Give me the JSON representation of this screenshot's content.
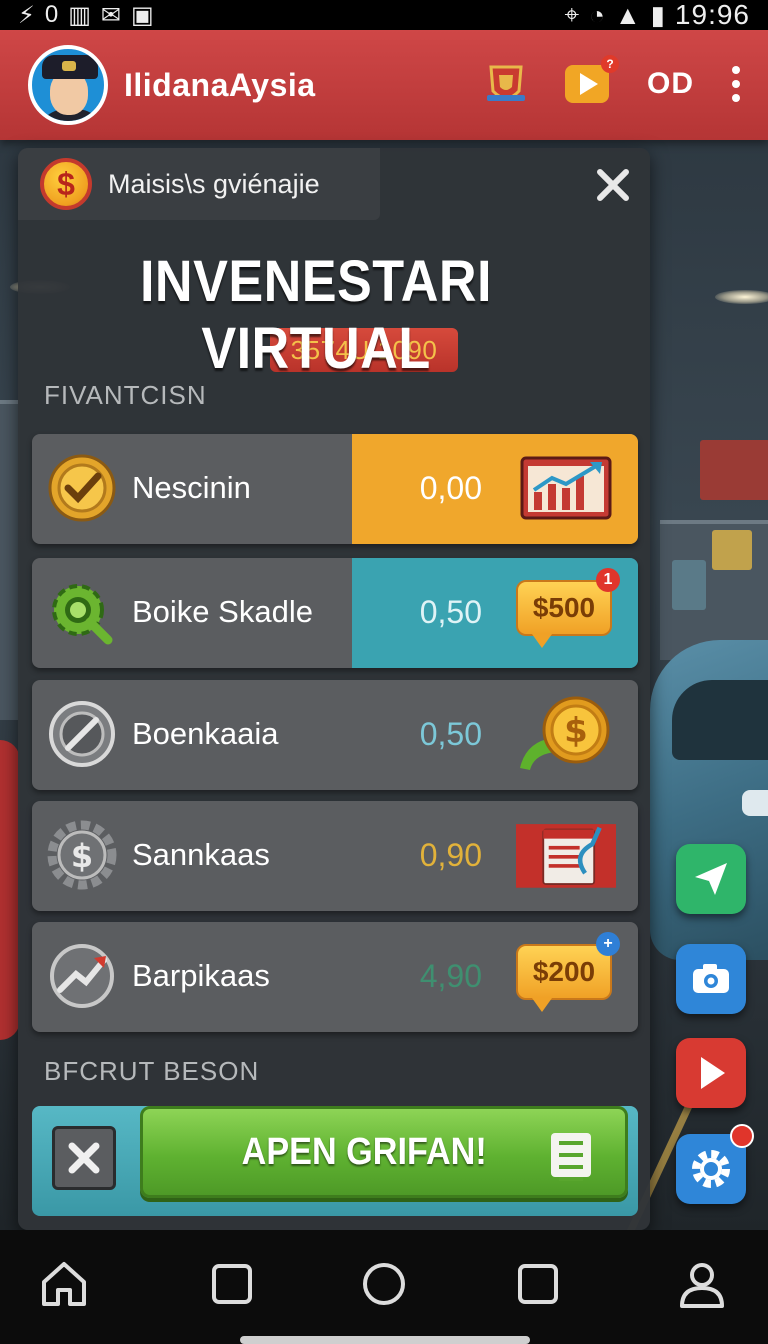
{
  "status_bar": {
    "left_text": "0",
    "time": "19:96"
  },
  "header": {
    "username": "IlidanaAysia",
    "coins": "OD"
  },
  "dialog": {
    "tab_label": "Maisis\\s gviénajie",
    "title": "INVENESTARI VIRTUAL",
    "code": "3574U 1090",
    "section1_label": "FIVANTCISN",
    "section2_label": "BFCRUT BESON",
    "rows": [
      {
        "label": "Nescinin",
        "value": "0,00",
        "value_color": "#ffffff",
        "accent": "#f0a72c",
        "icon": "check-medal-icon",
        "art": "chart-screen-icon"
      },
      {
        "label": "Boike Skadle",
        "value": "0,50",
        "value_color": "#dff3f6",
        "accent": "#3aa3b1",
        "icon": "gear-magnifier-icon",
        "art": "price-bubble",
        "bubble_text": "$500",
        "bubble_badge": "1"
      },
      {
        "label": "Boenkaaia",
        "value": "0,50",
        "value_color": "#7cc8d8",
        "icon": "slash-circle-icon",
        "art": "gold-coin-icon"
      },
      {
        "label": "Sannkaas",
        "value": "0,90",
        "value_color": "#e2b23a",
        "icon": "dollar-gear-icon",
        "art": "calendar-card-icon"
      },
      {
        "label": "Barpikaas",
        "value": "4,90",
        "value_color": "#3f8f70",
        "icon": "trend-circle-icon",
        "art": "price-bubble",
        "bubble_text": "$200",
        "bubble_badge": "+"
      }
    ],
    "open_button_label": "APEN GRIFAN!"
  },
  "colors": {
    "header_red": "#c53f3f",
    "panel": "#303438",
    "accent_orange": "#f0a72c",
    "accent_teal": "#3aa3b1",
    "green_button": "#5fb231"
  },
  "side_buttons": [
    "send-icon",
    "camera-icon",
    "play-icon",
    "settings-gear-icon"
  ],
  "nav": [
    "home-icon",
    "square-icon",
    "circle-home-icon",
    "recents-square-icon",
    "profile-icon"
  ]
}
